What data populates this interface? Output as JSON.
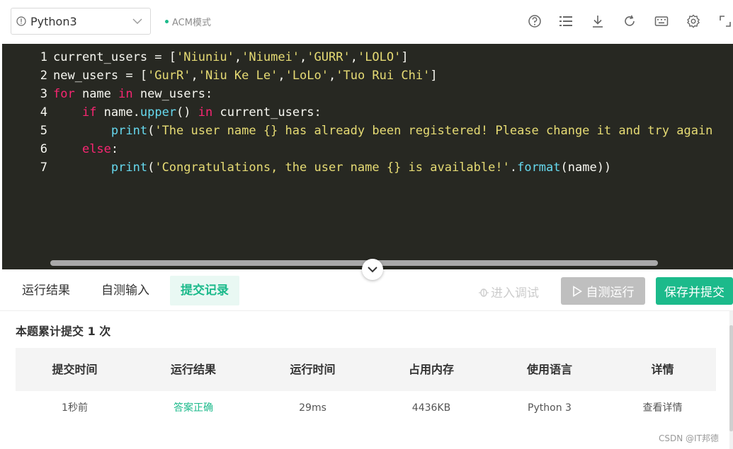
{
  "toolbar": {
    "language": "Python3",
    "mode": "ACM模式",
    "icons": [
      "help-circle-icon",
      "list-icon",
      "download-icon",
      "refresh-icon",
      "keyboard-icon",
      "gear-icon",
      "fullscreen-icon"
    ]
  },
  "editor": {
    "line_numbers": [
      "1",
      "2",
      "3",
      "4",
      "5",
      "6",
      "7"
    ],
    "lines": [
      [
        [
          "t",
          "current_users = ["
        ],
        [
          "s",
          "'Niuniu'"
        ],
        [
          "t",
          ","
        ],
        [
          "s",
          "'Niumei'"
        ],
        [
          "t",
          ","
        ],
        [
          "s",
          "'GURR'"
        ],
        [
          "t",
          ","
        ],
        [
          "s",
          "'LOLO'"
        ],
        [
          "t",
          "]"
        ]
      ],
      [
        [
          "t",
          "new_users = ["
        ],
        [
          "s",
          "'GurR'"
        ],
        [
          "t",
          ","
        ],
        [
          "s",
          "'Niu Ke Le'"
        ],
        [
          "t",
          ","
        ],
        [
          "s",
          "'LoLo'"
        ],
        [
          "t",
          ","
        ],
        [
          "s",
          "'Tuo Rui Chi'"
        ],
        [
          "t",
          "]"
        ]
      ],
      [
        [
          "k",
          "for"
        ],
        [
          "t",
          " name "
        ],
        [
          "k",
          "in"
        ],
        [
          "t",
          " new_users:"
        ]
      ],
      [
        [
          "t",
          "    "
        ],
        [
          "k",
          "if"
        ],
        [
          "t",
          " name."
        ],
        [
          "f",
          "upper"
        ],
        [
          "t",
          "() "
        ],
        [
          "k",
          "in"
        ],
        [
          "t",
          " current_users:"
        ]
      ],
      [
        [
          "t",
          "        "
        ],
        [
          "f",
          "print"
        ],
        [
          "t",
          "("
        ],
        [
          "s",
          "'The user name {} has already been registered! Please change it and try again"
        ]
      ],
      [
        [
          "t",
          "    "
        ],
        [
          "k",
          "else"
        ],
        [
          "t",
          ":"
        ]
      ],
      [
        [
          "t",
          "        "
        ],
        [
          "f",
          "print"
        ],
        [
          "t",
          "("
        ],
        [
          "s",
          "'Congratulations, the user name {} is available!'"
        ],
        [
          "t",
          "."
        ],
        [
          "f",
          "format"
        ],
        [
          "t",
          "(name))"
        ]
      ]
    ]
  },
  "tabs": [
    {
      "label": "运行结果",
      "active": false
    },
    {
      "label": "自测输入",
      "active": false
    },
    {
      "label": "提交记录",
      "active": true
    }
  ],
  "actions": {
    "debug": "进入调试",
    "run": "自测运行",
    "submit": "保存并提交"
  },
  "submissions": {
    "summary": "本题累计提交 1 次",
    "headers": [
      "提交时间",
      "运行结果",
      "运行时间",
      "占用内存",
      "使用语言",
      "详情"
    ],
    "rows": [
      [
        "1秒前",
        "答案正确",
        "29ms",
        "4436KB",
        "Python 3",
        "查看详情"
      ]
    ]
  },
  "watermark": "CSDN @IT邦德",
  "colors": {
    "accent": "#1cba8b",
    "editor_bg": "#272822",
    "keyword": "#f92672",
    "function": "#66d9ef",
    "string": "#e6db74"
  }
}
